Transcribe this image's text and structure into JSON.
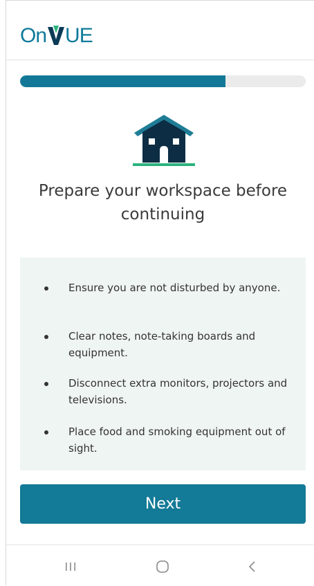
{
  "header": {
    "logo_text_left": "On",
    "logo_text_right": "UE",
    "logo_color": "#0e7a9a"
  },
  "progress": {
    "fraction": 0.72,
    "fill_color": "#137897",
    "track_color": "#ebebeb"
  },
  "illustration": {
    "icon": "house-icon",
    "roof_color": "#1f7d96",
    "body_color": "#0d2d45",
    "ground_color": "#2bb37e"
  },
  "main": {
    "title": "Prepare your workspace before continuing",
    "checklist": [
      "Ensure you are not disturbed by anyone.",
      "Clear notes, note-taking boards and equipment.",
      "Disconnect extra monitors, projectors and televisions.",
      "Place food and smoking equipment out of sight."
    ],
    "next_label": "Next",
    "accent_color": "#137a97"
  },
  "system_nav": {
    "recent_apps_icon": "recent-apps-icon",
    "home_icon": "home-icon",
    "back_icon": "back-icon"
  }
}
